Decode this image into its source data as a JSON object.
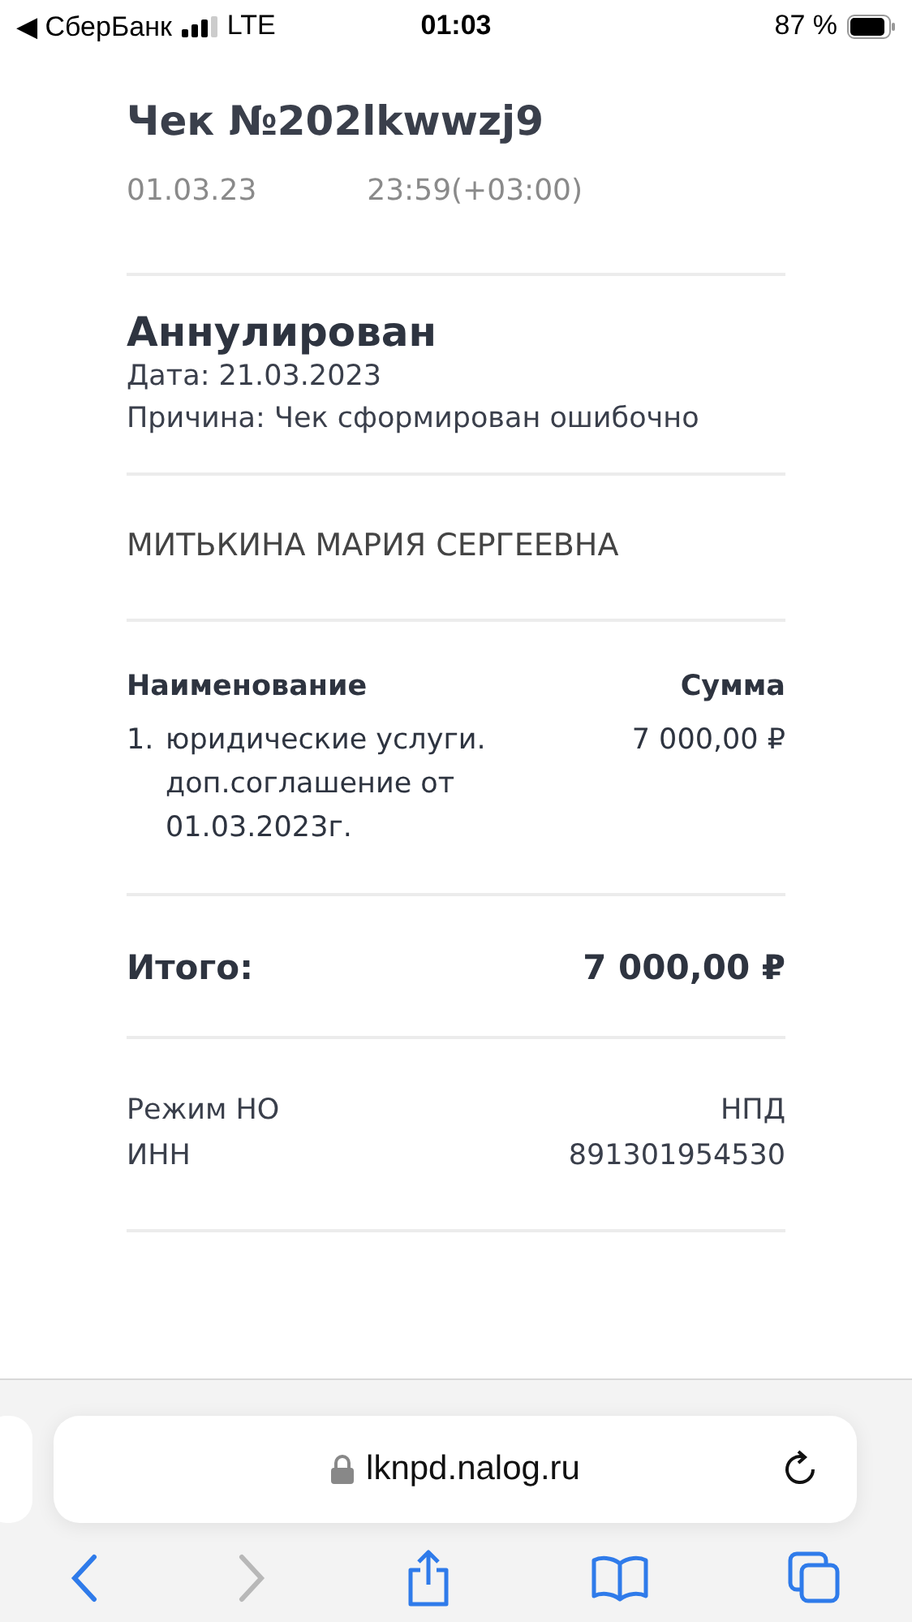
{
  "status_bar": {
    "back_app": "◀ СберБанк",
    "network": "LTE",
    "time": "01:03",
    "battery": "87 %"
  },
  "receipt": {
    "title": "Чек №202lkwwzj9",
    "date": "01.03.23",
    "time": "23:59(+03:00)",
    "cancel": {
      "status": "Аннулирован",
      "date": "Дата: 21.03.2023",
      "reason": "Причина: Чек сформирован ошибочно"
    },
    "customer": "МИТЬКИНА МАРИЯ СЕРГЕЕВНА",
    "columns": [
      "Наименование",
      "Сумма"
    ],
    "items": [
      {
        "number": "1.",
        "name": "юридические услуги. доп.соглашение от 01.03.2023г.",
        "amount": "7 000,00 ₽"
      }
    ],
    "total": {
      "label": "Итого:",
      "amount": "7 000,00 ₽"
    },
    "details": [
      {
        "label": "Режим НО",
        "value": "НПД"
      },
      {
        "label": "ИНН",
        "value": "891301954530"
      }
    ]
  },
  "browser": {
    "url": "lknpd.nalog.ru",
    "back_disabled": false,
    "forward_disabled": true
  }
}
